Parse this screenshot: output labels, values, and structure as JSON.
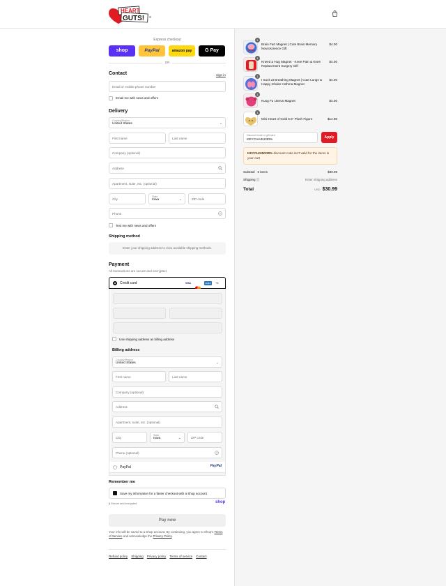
{
  "brand": {
    "logo_text": "HEART GUTS!"
  },
  "express": {
    "label": "Express checkout",
    "or": "OR",
    "shop": "shop",
    "paypal": "PayPal",
    "amazon": "amazon pay",
    "gpay": "G Pay"
  },
  "contact": {
    "title": "Contact",
    "signin": "Sign in",
    "email_placeholder": "Email or mobile phone number",
    "news": "Email me with news and offers"
  },
  "delivery": {
    "title": "Delivery",
    "country_label": "Country/Region",
    "country_value": "United States",
    "first": "First name",
    "last": "Last name",
    "company": "Company (optional)",
    "address": "Address",
    "apartment": "Apartment, suite, etc. (optional)",
    "city": "City",
    "state_label": "State",
    "state_value": "Iowa",
    "zip": "ZIP code",
    "phone": "Phone",
    "text_news": "Text me with news and offers"
  },
  "shipping": {
    "title": "Shipping method",
    "notice": "Enter your shipping address to view available shipping methods."
  },
  "payment": {
    "title": "Payment",
    "subtitle": "All transactions are secure and encrypted.",
    "credit": "Credit card",
    "visa": "VISA",
    "mc": "MC",
    "amex": "AMEX",
    "more": "+4",
    "use_shipping": "Use shipping address as billing address",
    "billing_title": "Billing address",
    "country_label": "Country/Region",
    "country_value": "United States",
    "first": "First name",
    "last": "Last name",
    "company": "Company (optional)",
    "address": "Address",
    "apartment": "Apartment, suite, etc. (optional)",
    "city": "City",
    "state_label": "State",
    "state_value": "Iowa",
    "zip": "ZIP code",
    "phone": "Phone (optional)",
    "paypal": "PayPal",
    "paypal_logo": "PayPal"
  },
  "remember": {
    "title": "Remember me",
    "save": "Save my information for a faster checkout with a Shop account",
    "secure": "Secure and encrypted",
    "shop": "shop"
  },
  "pay": {
    "label": "Pay now",
    "terms_1": "Your info will be saved to a Shop account. By continuing, you agree to Shop's",
    "terms_link": "Terms of Service",
    "terms_2": "and acknowledge the",
    "privacy_link": "Privacy Policy",
    "terms_end": "."
  },
  "footer": [
    "Refund policy",
    "Shipping",
    "Privacy policy",
    "Terms of service",
    "Contact"
  ],
  "cart": {
    "items": [
      {
        "name": "Brain Fart Magnet | Cute Brain Memory Neuroscience Gift",
        "price": "$4.00",
        "qty": "1"
      },
      {
        "name": "Kneed a Hug Magnet - Knee Pain & Knee Replacement Surgery Gift",
        "price": "$4.00",
        "qty": "1"
      },
      {
        "name": "I Suck at Breathing Magnet | Cute Lungs w Happy Inhaler Asthma Magnet",
        "price": "$4.00",
        "qty": "1"
      },
      {
        "name": "Kung Fu Uterus Magnet",
        "price": "$4.00",
        "qty": "1"
      },
      {
        "name": "Mini Heart of Gold 6.5\" Plush Figure",
        "price": "$14.99",
        "qty": "1"
      }
    ],
    "discount_label": "Discount code or gift card",
    "discount_value": "KEYCHAINS30%",
    "apply": "Apply",
    "warning_code": "KEYCHAINS30%",
    "warning_text": "discount code isn't valid for the items in your cart",
    "subtotal_label": "Subtotal · 5 items",
    "subtotal": "$30.99",
    "shipping_label": "Shipping",
    "shipping_value": "Enter shipping address",
    "total_label": "Total",
    "currency": "USD",
    "total": "$30.99"
  },
  "colors": {
    "shop": "#5a31f4",
    "paypal": "#ffc439",
    "amazon": "#ffd814",
    "gpay": "#000000",
    "apply": "#e01b24",
    "warning_bg": "#fff4e5"
  }
}
